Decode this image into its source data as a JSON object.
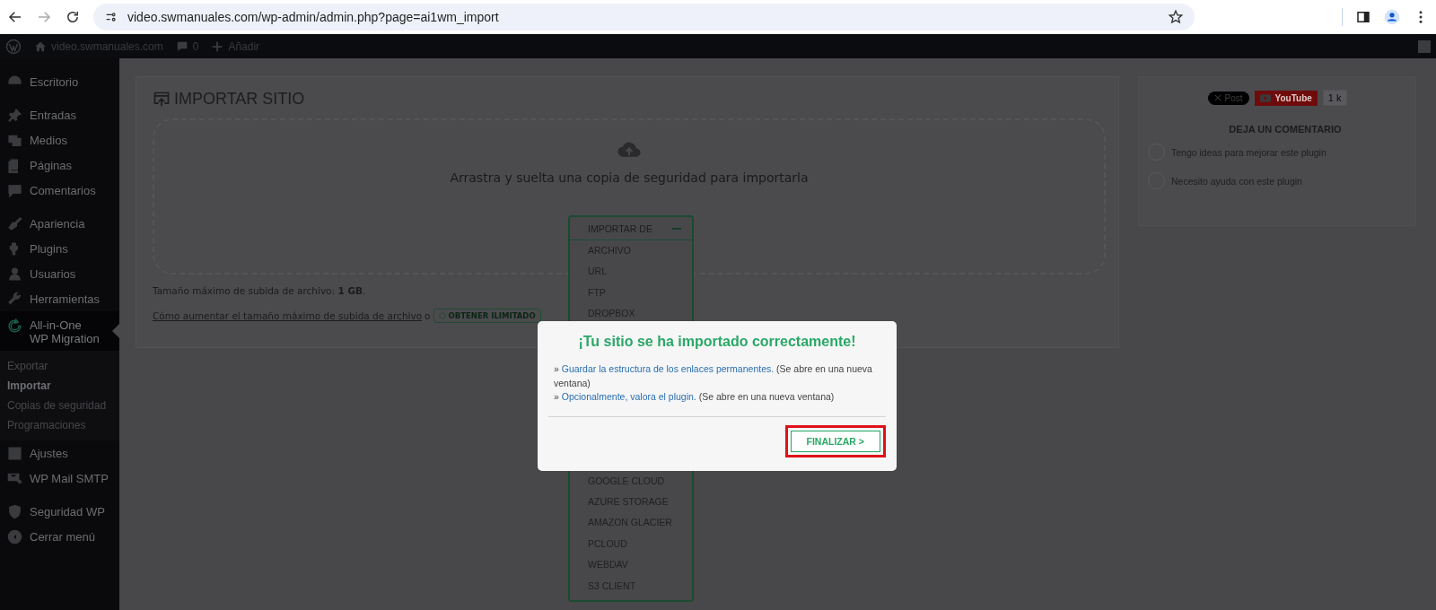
{
  "browser": {
    "url": "video.swmanuales.com/wp-admin/admin.php?page=ai1wm_import"
  },
  "admin_bar": {
    "site": "video.swmanuales.com",
    "comments": "0",
    "new": "Añadir"
  },
  "sidebar": {
    "groups": [
      [
        {
          "label": "Escritorio",
          "selected": false
        }
      ],
      [
        {
          "label": "Entradas",
          "selected": false
        },
        {
          "label": "Medios",
          "selected": false
        },
        {
          "label": "Páginas",
          "selected": false
        },
        {
          "label": "Comentarios",
          "selected": false
        }
      ],
      [
        {
          "label": "Apariencia",
          "selected": false
        },
        {
          "label": "Plugins",
          "selected": false
        },
        {
          "label": "Usuarios",
          "selected": false
        },
        {
          "label": "Herramientas",
          "selected": false
        },
        {
          "label": "All-in-One WP Migration",
          "selected": true,
          "children": [
            {
              "label": "Exportar",
              "selected": false
            },
            {
              "label": "Importar",
              "selected": true
            },
            {
              "label": "Copias de seguridad",
              "selected": false
            },
            {
              "label": "Programaciones",
              "selected": false
            }
          ]
        },
        {
          "label": "Ajustes",
          "selected": false
        },
        {
          "label": "WP Mail SMTP",
          "selected": false
        }
      ],
      [
        {
          "label": "Seguridad WP",
          "selected": false
        },
        {
          "label": "Cerrar menú",
          "selected": false
        }
      ]
    ]
  },
  "import_panel": {
    "title": "IMPORTAR SITIO",
    "dropzone_text": "Arrastra y suelta una copia de seguridad para importarla",
    "dropdown": {
      "label": "IMPORTAR DE",
      "expanded": true,
      "items": [
        "ARCHIVO",
        "URL",
        "FTP",
        "DROPBOX"
      ],
      "items_below": [
        "GOOGLE CLOUD",
        "AZURE STORAGE",
        "AMAZON GLACIER",
        "PCLOUD",
        "WEBDAV",
        "S3 CLIENT"
      ]
    },
    "max_size": "Tamaño máximo de subida de archivo: **1 GB**.",
    "help_link": "Cómo aumentar el tamaño máximo de subida de archivo",
    "help_or": "o",
    "unlimited_button": "OBTENER ILIMITADO"
  },
  "side_panel": {
    "post_button": "Post",
    "youtube_button": "YouTube",
    "youtube_count": "1 k",
    "heading": "DEJA UN COMENTARIO",
    "options": [
      {
        "label": "Tengo ideas para mejorar este plugin",
        "selected": false
      },
      {
        "label": "Necesito ayuda con este plugin",
        "selected": false
      }
    ]
  },
  "dialog": {
    "title": "¡Tu sitio se ha importado correctamente!",
    "lines": [
      {
        "bullet": "»",
        "link": "Guardar la estructura de los enlaces permanentes.",
        "note": "(Se abre en una nueva ventana)"
      },
      {
        "bullet": "»",
        "link": "Opcionalmente, valora el plugin.",
        "note": "(Se abre en una nueva ventana)"
      }
    ],
    "button": "FINALIZAR >",
    "button_highlighted": true
  }
}
